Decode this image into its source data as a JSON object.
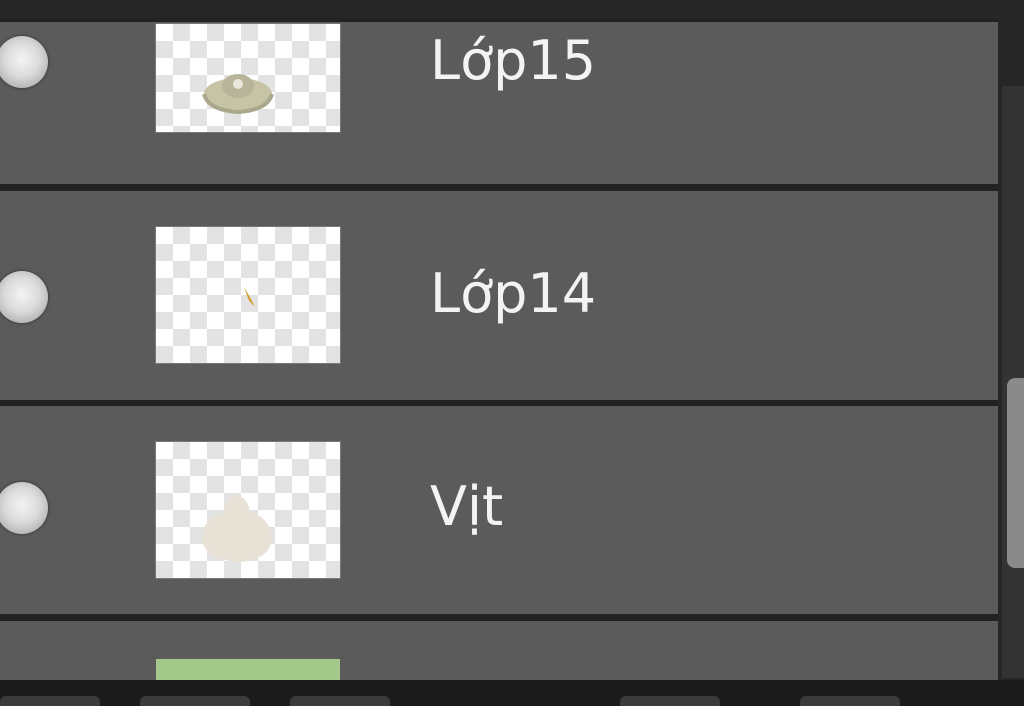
{
  "layers_panel": {
    "layers": [
      {
        "name": "Lớp15",
        "thumbnail": "grey-ring-shape"
      },
      {
        "name": "Lớp14",
        "thumbnail": "small-orange-mark"
      },
      {
        "name": "Vịt",
        "thumbnail": "beige-blob"
      },
      {
        "name": "",
        "thumbnail": "green-fill"
      }
    ]
  },
  "colors": {
    "panel_bg": "#262626",
    "row_bg": "#5b5b5b",
    "text": "#f3f3f3",
    "green_layer": "#a3c88a"
  }
}
